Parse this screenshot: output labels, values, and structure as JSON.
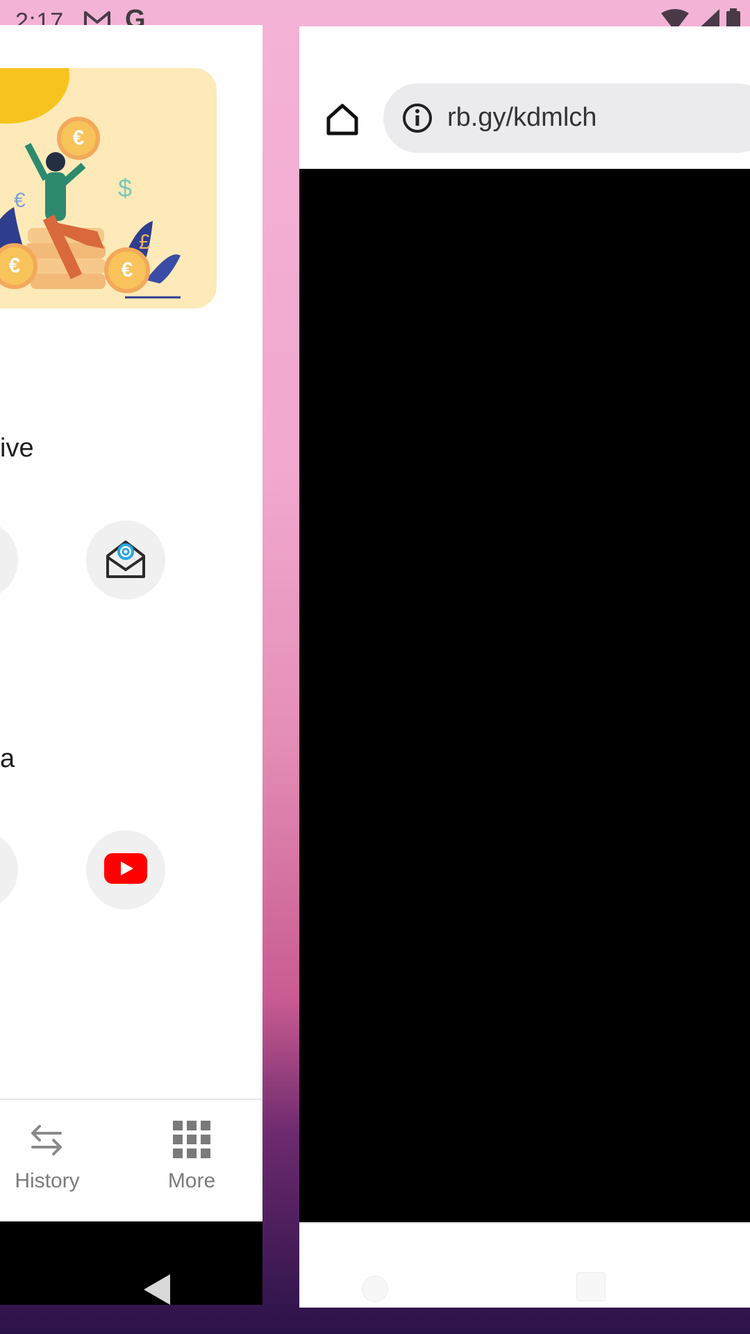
{
  "status_bar": {
    "time": "2:17",
    "icons": [
      "gmail-icon",
      "google-icon",
      "wifi-icon",
      "signal-icon",
      "battery-icon"
    ],
    "google_letter": "G"
  },
  "left_app": {
    "section1_partial_title": "ive",
    "section2_partial_title": "a",
    "promo_coin_symbol": "€",
    "bottom_nav": [
      {
        "label": "History",
        "icon": "swap-arrows-icon"
      },
      {
        "label": "More",
        "icon": "grid-icon"
      }
    ]
  },
  "browser": {
    "url": "rb.gy/kdmlch"
  },
  "colors": {
    "promo_bg": "#fdeab8",
    "accent_yellow": "#f7c31e",
    "youtube_red": "#ff0000"
  }
}
